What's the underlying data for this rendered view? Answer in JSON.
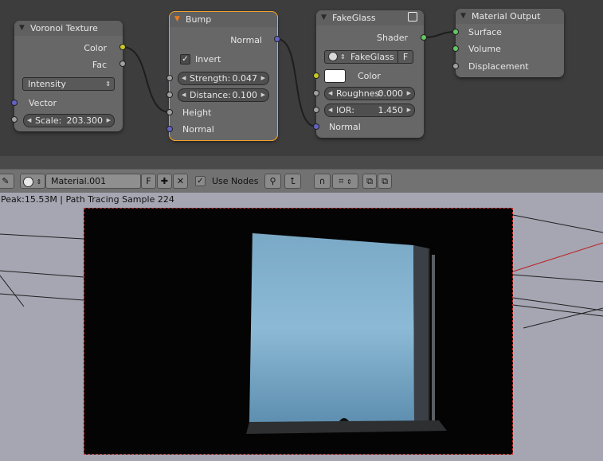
{
  "nodes": {
    "voronoi": {
      "title": "Voronoi Texture",
      "outputs": [
        "Color",
        "Fac"
      ],
      "coloring": "Intensity",
      "vector_label": "Vector",
      "scale_label": "Scale:",
      "scale_value": "203.300"
    },
    "bump": {
      "title": "Bump",
      "output": "Normal",
      "invert_label": "Invert",
      "invert_checked": "✓",
      "strength_label": "Strength:",
      "strength_value": "0.047",
      "distance_label": "Distance:",
      "distance_value": "0.100",
      "height_label": "Height",
      "normal_label": "Normal"
    },
    "fakeglass": {
      "title": "FakeGlass",
      "output": "Shader",
      "group_name": "FakeGlass",
      "fake_user": "F",
      "color_label": "Color",
      "color_value": "#ffffff",
      "roughness_label": "Roughnes:",
      "roughness_value": "0.000",
      "ior_label": "IOR:",
      "ior_value": "1.450",
      "normal_label": "Normal"
    },
    "material_output": {
      "title": "Material Output",
      "inputs": [
        "Surface",
        "Volume",
        "Displacement"
      ]
    }
  },
  "header": {
    "material_name": "Material.001",
    "fake_user": "F",
    "use_nodes_label": "Use Nodes",
    "use_nodes_checked": "✓"
  },
  "render": {
    "status": "Peak:15.53M | Path Tracing Sample 224"
  },
  "colors": {
    "socket_color": "#c7c729",
    "socket_float": "#a1a1a1",
    "socket_vector": "#6363c7",
    "socket_shader": "#63c763",
    "selected_outline": "#f0a030"
  }
}
